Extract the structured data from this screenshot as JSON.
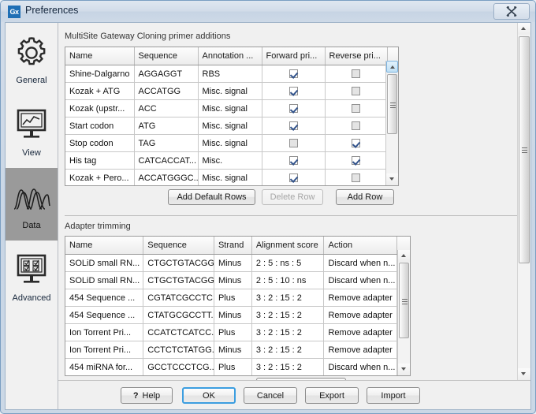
{
  "window": {
    "title": "Preferences",
    "app_badge": "Gx",
    "close_label": "Close"
  },
  "sidebar": {
    "items": [
      {
        "label": "General",
        "icon": "gear-icon",
        "selected": false
      },
      {
        "label": "View",
        "icon": "monitor-chart-icon",
        "selected": false
      },
      {
        "label": "Data",
        "icon": "chromatogram-icon",
        "selected": true
      },
      {
        "label": "Advanced",
        "icon": "monitor-checkboxes-icon",
        "selected": false
      }
    ]
  },
  "sections": {
    "primer": {
      "title": "MultiSite Gateway Cloning primer additions",
      "columns": [
        "Name",
        "Sequence",
        "Annotation ...",
        "Forward pri...",
        "Reverse pri..."
      ],
      "rows": [
        {
          "name": "Shine-Dalgarno",
          "sequence": "AGGAGGT",
          "annotation": "RBS",
          "forward": true,
          "reverse": false
        },
        {
          "name": "Kozak + ATG",
          "sequence": "ACCATGG",
          "annotation": "Misc. signal",
          "forward": true,
          "reverse": false
        },
        {
          "name": "Kozak (upstr...",
          "sequence": "ACC",
          "annotation": "Misc. signal",
          "forward": true,
          "reverse": false
        },
        {
          "name": "Start codon",
          "sequence": "ATG",
          "annotation": "Misc. signal",
          "forward": true,
          "reverse": false
        },
        {
          "name": "Stop codon",
          "sequence": "TAG",
          "annotation": "Misc. signal",
          "forward": false,
          "reverse": true
        },
        {
          "name": "His tag",
          "sequence": "CATCACCAT...",
          "annotation": "Misc.",
          "forward": true,
          "reverse": true
        },
        {
          "name": "Kozak + Pero...",
          "sequence": "ACCATGGGC...",
          "annotation": "Misc. signal",
          "forward": true,
          "reverse": false
        }
      ],
      "buttons": {
        "add_default": "Add Default Rows",
        "delete_row": "Delete Row",
        "add_row": "Add Row"
      }
    },
    "adapter": {
      "title": "Adapter trimming",
      "columns": [
        "Name",
        "Sequence",
        "Strand",
        "Alignment score",
        "Action"
      ],
      "rows": [
        {
          "name": "SOLiD small RN...",
          "sequence": "CTGCTGTACGG...",
          "strand": "Minus",
          "score": "2 : 5 : ns : 5",
          "action": "Discard when n..."
        },
        {
          "name": "SOLiD small RN...",
          "sequence": "CTGCTGTACGG...",
          "strand": "Minus",
          "score": "2 : 5 : 10 : ns",
          "action": "Discard when n..."
        },
        {
          "name": "454 Sequence ...",
          "sequence": "CGTATCGCCTC...",
          "strand": "Plus",
          "score": "3 : 2 : 15 : 2",
          "action": "Remove adapter"
        },
        {
          "name": "454 Sequence ...",
          "sequence": "CTATGCGCCTT...",
          "strand": "Minus",
          "score": "3 : 2 : 15 : 2",
          "action": "Remove adapter"
        },
        {
          "name": "Ion Torrent Pri...",
          "sequence": "CCATCTCATCC...",
          "strand": "Plus",
          "score": "3 : 2 : 15 : 2",
          "action": "Remove adapter"
        },
        {
          "name": "Ion Torrent Pri...",
          "sequence": "CCTCTCTATGG...",
          "strand": "Minus",
          "score": "3 : 2 : 15 : 2",
          "action": "Remove adapter"
        },
        {
          "name": "454 miRNA for...",
          "sequence": "GCCTCCCTCG...",
          "strand": "Plus",
          "score": "3 : 2 : 15 : 2",
          "action": "Discard when n..."
        }
      ]
    }
  },
  "footer": {
    "help": "Help",
    "ok": "OK",
    "cancel": "Cancel",
    "export": "Export",
    "import": "Import"
  },
  "colors": {
    "accent": "#3c9ee0",
    "selected_sidebar": "#9a9a9a",
    "checkmark": "#33548c",
    "badge": "#1f6fb5"
  }
}
